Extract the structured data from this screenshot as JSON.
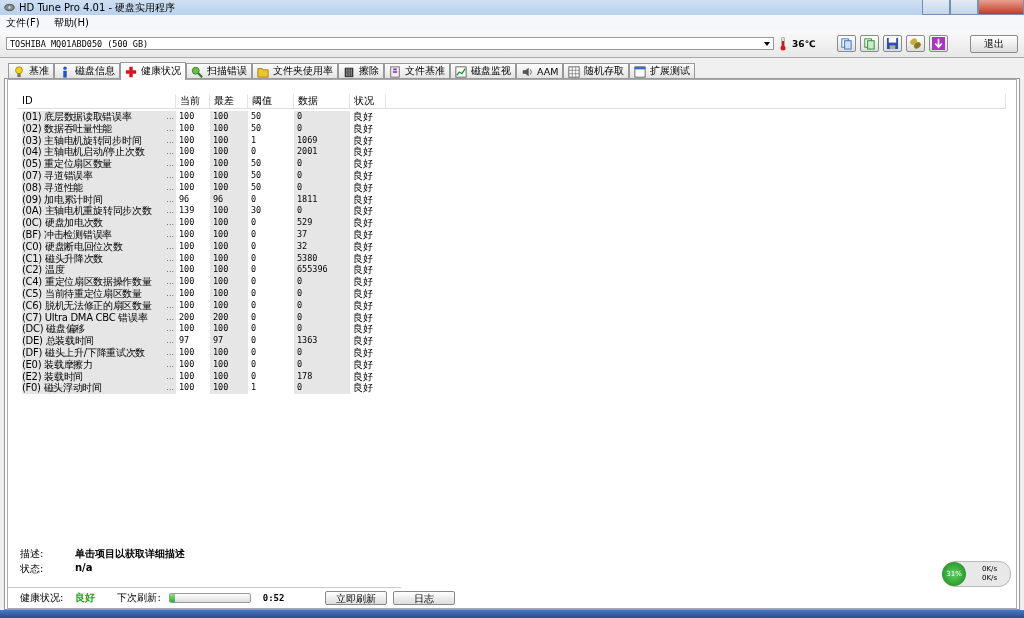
{
  "window": {
    "title": "HD Tune Pro 4.01 - 硬盘实用程序"
  },
  "menu": [
    "文件(F)",
    "帮助(H)"
  ],
  "drive": {
    "value": "TOSHIBA MQ01ABD050 (500 GB)",
    "temperature": "36℃"
  },
  "exit_button": "退出",
  "tabs": [
    {
      "label": "基准",
      "selected": false
    },
    {
      "label": "磁盘信息",
      "selected": false
    },
    {
      "label": "健康状况",
      "selected": true
    },
    {
      "label": "扫描错误",
      "selected": false
    },
    {
      "label": "文件夹使用率",
      "selected": false
    },
    {
      "label": "擦除",
      "selected": false
    },
    {
      "label": "文件基准",
      "selected": false
    },
    {
      "label": "磁盘监视",
      "selected": false
    },
    {
      "label": "AAM",
      "selected": false
    },
    {
      "label": "随机存取",
      "selected": false
    },
    {
      "label": "扩展测试",
      "selected": false
    }
  ],
  "table": {
    "columns": [
      "ID",
      "当前",
      "最差",
      "阈值",
      "数据",
      "状况"
    ],
    "rows": [
      {
        "attribute": "(01) 底层数据读取错误率",
        "ellipsis": "...",
        "current": "100",
        "worst": "100",
        "threshold": "50",
        "data": "0",
        "status": "良好"
      },
      {
        "attribute": "(02) 数据吞吐量性能",
        "ellipsis": "...",
        "current": "100",
        "worst": "100",
        "threshold": "50",
        "data": "0",
        "status": "良好"
      },
      {
        "attribute": "(03) 主轴电机旋转同步时间",
        "ellipsis": "...",
        "current": "100",
        "worst": "100",
        "threshold": "1",
        "data": "1069",
        "status": "良好"
      },
      {
        "attribute": "(04) 主轴电机启动/停止次数",
        "ellipsis": "...",
        "current": "100",
        "worst": "100",
        "threshold": "0",
        "data": "2001",
        "status": "良好"
      },
      {
        "attribute": "(05) 重定位扇区数量",
        "ellipsis": "...",
        "current": "100",
        "worst": "100",
        "threshold": "50",
        "data": "0",
        "status": "良好"
      },
      {
        "attribute": "(07) 寻道错误率",
        "ellipsis": "...",
        "current": "100",
        "worst": "100",
        "threshold": "50",
        "data": "0",
        "status": "良好"
      },
      {
        "attribute": "(08) 寻道性能",
        "ellipsis": "...",
        "current": "100",
        "worst": "100",
        "threshold": "50",
        "data": "0",
        "status": "良好"
      },
      {
        "attribute": "(09) 加电累计时间",
        "ellipsis": "...",
        "current": "96",
        "worst": "96",
        "threshold": "0",
        "data": "1811",
        "status": "良好"
      },
      {
        "attribute": "(0A) 主轴电机重旋转同步次数",
        "ellipsis": "...",
        "current": "139",
        "worst": "100",
        "threshold": "30",
        "data": "0",
        "status": "良好"
      },
      {
        "attribute": "(0C) 硬盘加电次数",
        "ellipsis": "...",
        "current": "100",
        "worst": "100",
        "threshold": "0",
        "data": "529",
        "status": "良好"
      },
      {
        "attribute": "(BF) 冲击检测错误率",
        "ellipsis": "...",
        "current": "100",
        "worst": "100",
        "threshold": "0",
        "data": "37",
        "status": "良好"
      },
      {
        "attribute": "(C0) 硬盘断电回位次数",
        "ellipsis": "...",
        "current": "100",
        "worst": "100",
        "threshold": "0",
        "data": "32",
        "status": "良好"
      },
      {
        "attribute": "(C1) 磁头升降次数",
        "ellipsis": "...",
        "current": "100",
        "worst": "100",
        "threshold": "0",
        "data": "5380",
        "status": "良好"
      },
      {
        "attribute": "(C2) 温度",
        "ellipsis": "...",
        "current": "100",
        "worst": "100",
        "threshold": "0",
        "data": "655396",
        "status": "良好"
      },
      {
        "attribute": "(C4) 重定位扇区数据操作数量",
        "ellipsis": "...",
        "current": "100",
        "worst": "100",
        "threshold": "0",
        "data": "0",
        "status": "良好"
      },
      {
        "attribute": "(C5) 当前待重定位扇区数量",
        "ellipsis": "...",
        "current": "100",
        "worst": "100",
        "threshold": "0",
        "data": "0",
        "status": "良好"
      },
      {
        "attribute": "(C6) 脱机无法修正的扇区数量",
        "ellipsis": "...",
        "current": "100",
        "worst": "100",
        "threshold": "0",
        "data": "0",
        "status": "良好"
      },
      {
        "attribute": "(C7) Ultra DMA CBC 错误率",
        "ellipsis": "...",
        "current": "200",
        "worst": "200",
        "threshold": "0",
        "data": "0",
        "status": "良好"
      },
      {
        "attribute": "(DC) 磁盘偏移",
        "ellipsis": "...",
        "current": "100",
        "worst": "100",
        "threshold": "0",
        "data": "0",
        "status": "良好"
      },
      {
        "attribute": "(DE) 总装载时间",
        "ellipsis": "...",
        "current": "97",
        "worst": "97",
        "threshold": "0",
        "data": "1363",
        "status": "良好"
      },
      {
        "attribute": "(DF) 磁头上升/下降重试次数",
        "ellipsis": "...",
        "current": "100",
        "worst": "100",
        "threshold": "0",
        "data": "0",
        "status": "良好"
      },
      {
        "attribute": "(E0) 装载摩擦力",
        "ellipsis": "...",
        "current": "100",
        "worst": "100",
        "threshold": "0",
        "data": "0",
        "status": "良好"
      },
      {
        "attribute": "(E2) 装载时间",
        "ellipsis": "...",
        "current": "100",
        "worst": "100",
        "threshold": "0",
        "data": "178",
        "status": "良好"
      },
      {
        "attribute": "(F0) 磁头浮动时间",
        "ellipsis": "...",
        "current": "100",
        "worst": "100",
        "threshold": "1",
        "data": "0",
        "status": "良好"
      }
    ]
  },
  "details": {
    "description_label": "描述:",
    "description": "单击项目以获取详细描述",
    "status_label": "状态:",
    "status": "n/a"
  },
  "footer": {
    "health_label": "健康状况:",
    "health": "良好",
    "refresh_label": "下次刷新:",
    "refresh": {
      "level": 0.06
    },
    "countdown": "0:52",
    "buttons": [
      "立即刷新",
      "日志"
    ]
  },
  "widget": {
    "percent": "31%",
    "upload": "0K/s",
    "download": "0K/s"
  }
}
